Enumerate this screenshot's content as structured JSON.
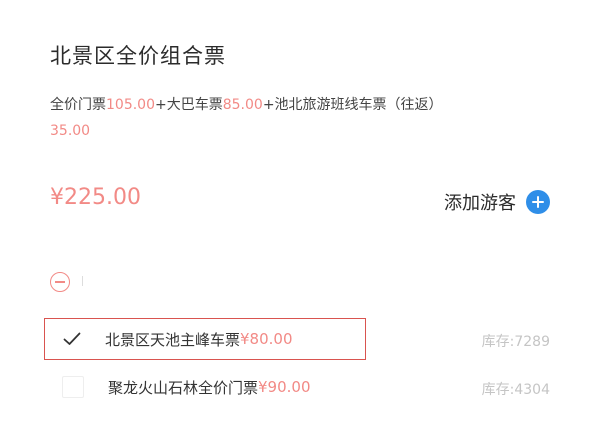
{
  "ticket": {
    "title": "北景区全价组合票",
    "description": {
      "part1": "全价门票",
      "price1": "105.00",
      "part2": "+大巴车票",
      "price2": "85.00",
      "part3": "+池北旅游班线车票（往返）",
      "price3": "35.00"
    },
    "total_price": "¥225.00",
    "add_visitor_label": "添加游客"
  },
  "options": [
    {
      "name": "北景区天池主峰车票",
      "price": "¥80.00",
      "stock": "库存:7289",
      "selected": true
    },
    {
      "name": "聚龙火山石林全价门票",
      "price": "¥90.00",
      "stock": "库存:4304",
      "selected": false
    }
  ],
  "colors": {
    "accent": "#f28a86",
    "blue": "#2f8ee8",
    "highlight_border": "#d9534f"
  }
}
